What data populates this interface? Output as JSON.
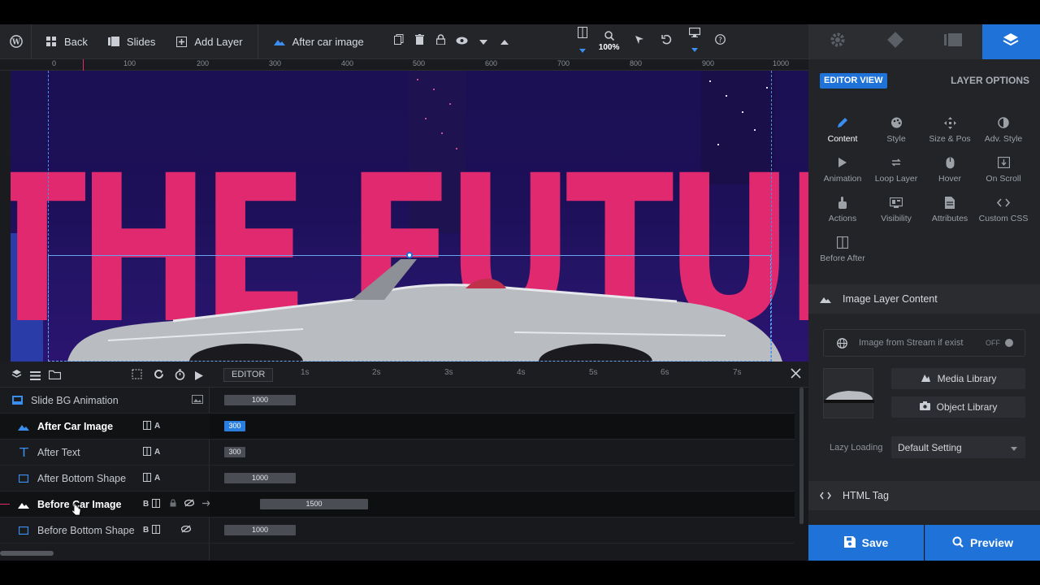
{
  "toolbar": {
    "back_label": "Back",
    "slides_label": "Slides",
    "add_layer_label": "Add Layer",
    "current_layer": "After car image",
    "zoom": "100%"
  },
  "ruler": {
    "ticks": [
      "0",
      "100",
      "200",
      "300",
      "400",
      "500",
      "600",
      "700",
      "800",
      "900",
      "1000"
    ]
  },
  "canvas": {
    "headline": "THE FUTURE"
  },
  "timeline": {
    "mode_label": "EDITOR",
    "time_marks": [
      "1s",
      "2s",
      "3s",
      "4s",
      "5s",
      "6s",
      "7s"
    ],
    "layers": [
      {
        "name": "Slide BG Animation",
        "bar_value": "1000",
        "badge": ""
      },
      {
        "name": "After Car Image",
        "bar_value": "300",
        "badge": "A"
      },
      {
        "name": "After Text",
        "bar_value": "300",
        "badge": "A"
      },
      {
        "name": "After Bottom Shape",
        "bar_value": "1000",
        "badge": "A"
      },
      {
        "name": "Before Car Image",
        "bar_value": "1500",
        "badge": "B"
      },
      {
        "name": "Before Bottom Shape",
        "bar_value": "1000",
        "badge": "B"
      }
    ]
  },
  "panel": {
    "editor_view": "EDITOR VIEW",
    "layer_options": "LAYER OPTIONS",
    "options": [
      {
        "label": "Content",
        "icon": "pencil-icon"
      },
      {
        "label": "Style",
        "icon": "palette-icon"
      },
      {
        "label": "Size & Pos",
        "icon": "move-icon"
      },
      {
        "label": "Adv. Style",
        "icon": "contrast-icon"
      },
      {
        "label": "Animation",
        "icon": "play-icon"
      },
      {
        "label": "Loop Layer",
        "icon": "loop-icon"
      },
      {
        "label": "Hover",
        "icon": "mouse-icon"
      },
      {
        "label": "On Scroll",
        "icon": "scroll-icon"
      },
      {
        "label": "Actions",
        "icon": "hand-icon"
      },
      {
        "label": "Visibility",
        "icon": "visibility-icon"
      },
      {
        "label": "Attributes",
        "icon": "document-icon"
      },
      {
        "label": "Custom CSS",
        "icon": "code-icon"
      },
      {
        "label": "Before After",
        "icon": "before-after-icon"
      }
    ],
    "image_section_title": "Image Layer Content",
    "stream_label": "Image from Stream if exist",
    "stream_toggle": "OFF",
    "media_library": "Media Library",
    "object_library": "Object Library",
    "lazy_label": "Lazy Loading",
    "lazy_value": "Default Setting",
    "html_tag_title": "HTML Tag",
    "save_label": "Save",
    "preview_label": "Preview"
  },
  "colors": {
    "accent": "#1f73d8",
    "headline": "#e0296e",
    "canvas_bg": "#1d0f58"
  }
}
